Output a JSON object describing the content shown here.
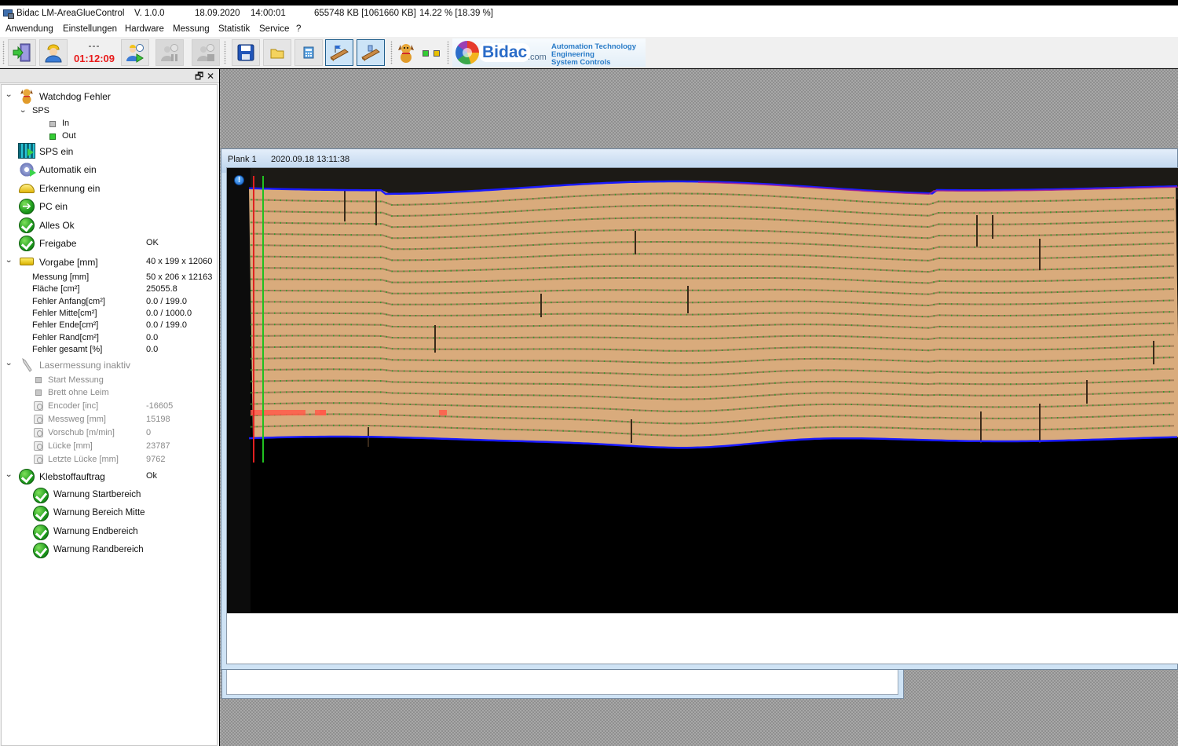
{
  "titlebar": {
    "app_name": "Bidac LM-AreaGlueControl",
    "version": "V. 1.0.0",
    "date": "18.09.2020",
    "time": "14:00:01",
    "memory": "655748 KB [1061660 KB]",
    "cpu": "14.22 % [18.39 %]"
  },
  "menu": [
    "Anwendung",
    "Einstellungen",
    "Hardware",
    "Messung",
    "Statistik",
    "Service",
    "?"
  ],
  "toolbar": {
    "buttons": [
      {
        "name": "exit-door-icon",
        "state": "normal"
      },
      {
        "name": "user-login-icon",
        "state": "normal"
      },
      {
        "name": "user-shift-start-icon",
        "state": "normal"
      },
      {
        "name": "user-shift-pause-icon",
        "state": "disabled"
      },
      {
        "name": "user-shift-stop-icon",
        "state": "disabled"
      },
      {
        "name": "save-disk-icon",
        "state": "normal"
      },
      {
        "name": "open-folder-icon",
        "state": "normal"
      },
      {
        "name": "calculator-icon",
        "state": "normal"
      },
      {
        "name": "board-flag-icon",
        "state": "active"
      },
      {
        "name": "board-tool-icon",
        "state": "active"
      }
    ],
    "timer_label": "---",
    "timer_value": "01:12:09",
    "timer_color": "#e81a1a",
    "leds": [
      {
        "state": "green",
        "color": "#33cc33"
      },
      {
        "state": "yellow",
        "color": "#e8c000"
      }
    ],
    "brand": {
      "logo_text": "Bidac",
      "domain": ".com",
      "tagline": [
        "Automation Technology",
        "Engineering",
        "System Controls"
      ]
    }
  },
  "left_panel": {
    "header_buttons": {
      "restore": "🗗",
      "close": "✕"
    },
    "chevron": "⌄",
    "watchdog": {
      "label": "Watchdog Fehler",
      "sps": {
        "label": "SPS",
        "in": "In",
        "out": "Out"
      }
    },
    "status_items": [
      {
        "label": "SPS ein",
        "icon": "sps-icon"
      },
      {
        "label": "Automatik ein",
        "icon": "gears-icon"
      },
      {
        "label": "Erkennung ein",
        "icon": "detection-icon"
      },
      {
        "label": "PC ein",
        "icon": "arrow-circle-icon"
      },
      {
        "label": "Alles Ok",
        "icon": "check-icon"
      },
      {
        "label": "Freigabe",
        "value": "OK",
        "icon": "check-icon"
      }
    ],
    "vorgabe": {
      "label": "Vorgabe [mm]",
      "value": "40 x 199 x 12060",
      "rows": [
        {
          "label": "Messung [mm]",
          "value": "50 x 206 x 12163"
        },
        {
          "label": "Fläche [cm²]",
          "value": "25055.8"
        },
        {
          "label": "Fehler Anfang[cm²]",
          "value": "0.0 / 199.0"
        },
        {
          "label": "Fehler Mitte[cm²]",
          "value": "0.0 / 1000.0"
        },
        {
          "label": "Fehler Ende[cm²]",
          "value": "0.0 / 199.0"
        },
        {
          "label": "Fehler Rand[cm²]",
          "value": "0.0"
        },
        {
          "label": "Fehler gesamt [%]",
          "value": "0.0"
        }
      ]
    },
    "laser": {
      "label": "Lasermessung inaktiv",
      "flags": [
        "Start Messung",
        "Brett ohne Leim"
      ],
      "rows": [
        {
          "label": "Encoder [inc]",
          "value": "-16605"
        },
        {
          "label": "Messweg [mm]",
          "value": "15198"
        },
        {
          "label": "Vorschub [m/min]",
          "value": "0"
        },
        {
          "label": "Lücke [mm]",
          "value": "23787"
        },
        {
          "label": "Letzte Lücke [mm]",
          "value": "9762"
        }
      ]
    },
    "klebstoff": {
      "label": "Klebstoffauftrag",
      "value": "Ok",
      "warnings": [
        "Warnung Startbereich",
        "Warnung Bereich Mitte",
        "Warnung Endbereich",
        "Warnung Randbereich"
      ]
    }
  },
  "plank_window": {
    "title": "Plank 1",
    "timestamp": "2020.09.18 13:11:38",
    "info_icon": "!",
    "overlay_colors": {
      "edge_line": "#1a1aff",
      "edge_alt": "#b0208a",
      "start_marker": "#e02020",
      "reference_marker": "#20c020",
      "glue_dots": "#2aa02a",
      "defect": "#ff5a4a",
      "wood": "#d9ab7c"
    }
  }
}
